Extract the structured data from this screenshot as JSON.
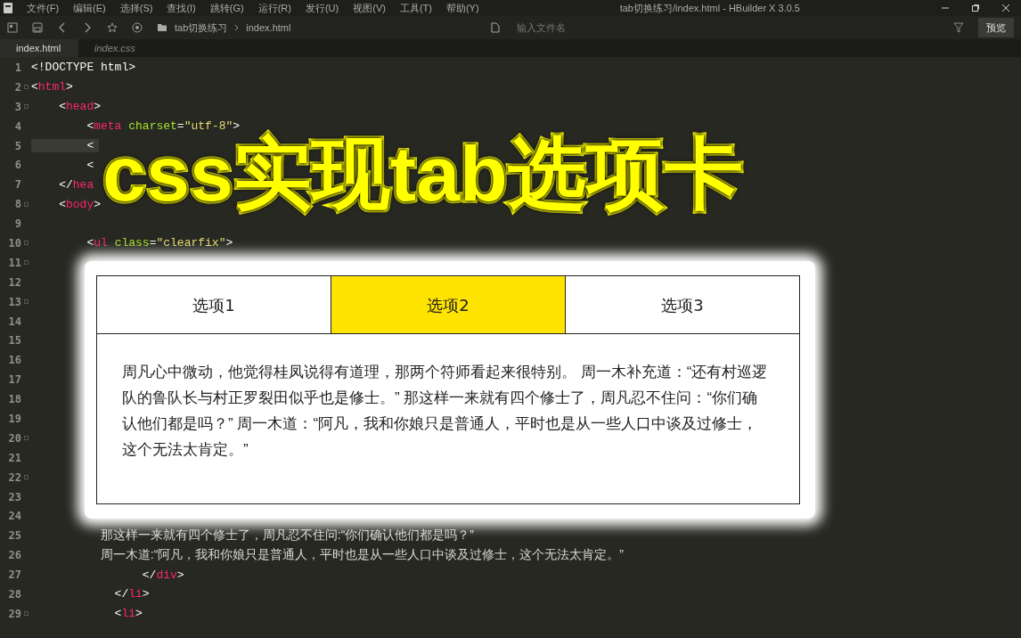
{
  "window": {
    "title": "tab切换练习/index.html - HBuilder X 3.0.5"
  },
  "menu": [
    "文件(F)",
    "编辑(E)",
    "选择(S)",
    "查找(I)",
    "跳转(G)",
    "运行(R)",
    "发行(U)",
    "视图(V)",
    "工具(T)",
    "帮助(Y)"
  ],
  "breadcrumb": [
    "tab切换练习",
    "index.html"
  ],
  "search": {
    "placeholder": "输入文件名"
  },
  "preview_button": "预览",
  "editor_tabs": [
    {
      "label": "index.html",
      "selected": true
    },
    {
      "label": "index.css",
      "selected": false
    }
  ],
  "code_lines": [
    {
      "number": "1",
      "fold": false,
      "current": false,
      "tokens": [
        {
          "kind": "punct",
          "text": "<!DOCTYPE html>"
        }
      ]
    },
    {
      "number": "2",
      "fold": true,
      "current": false,
      "tokens": [
        {
          "kind": "punct",
          "text": "<"
        },
        {
          "kind": "tag",
          "text": "html"
        },
        {
          "kind": "punct",
          "text": ">"
        }
      ]
    },
    {
      "number": "3",
      "fold": true,
      "current": false,
      "tokens": [
        {
          "kind": "punct",
          "text": "    <"
        },
        {
          "kind": "tag",
          "text": "head"
        },
        {
          "kind": "punct",
          "text": ">"
        }
      ]
    },
    {
      "number": "4",
      "fold": false,
      "current": false,
      "tokens": [
        {
          "kind": "punct",
          "text": "        <"
        },
        {
          "kind": "tag",
          "text": "meta"
        },
        {
          "kind": "attr",
          "text": " charset"
        },
        {
          "kind": "punct",
          "text": "="
        },
        {
          "kind": "string",
          "text": "\"utf-8\""
        },
        {
          "kind": "punct",
          "text": ">"
        }
      ]
    },
    {
      "number": "5",
      "fold": false,
      "current": true,
      "tokens": [
        {
          "kind": "punct",
          "text": "        <"
        }
      ]
    },
    {
      "number": "6",
      "fold": false,
      "current": false,
      "tokens": [
        {
          "kind": "punct",
          "text": "        <"
        }
      ]
    },
    {
      "number": "7",
      "fold": false,
      "current": false,
      "tokens": [
        {
          "kind": "punct",
          "text": "    </"
        },
        {
          "kind": "tag",
          "text": "hea"
        }
      ]
    },
    {
      "number": "8",
      "fold": true,
      "current": false,
      "tokens": [
        {
          "kind": "punct",
          "text": "    <"
        },
        {
          "kind": "tag",
          "text": "body"
        },
        {
          "kind": "punct",
          "text": ">"
        }
      ]
    },
    {
      "number": "9",
      "fold": false,
      "current": false
    },
    {
      "number": "10",
      "fold": true,
      "current": false,
      "tokens": [
        {
          "kind": "punct",
          "text": "        <"
        },
        {
          "kind": "tag",
          "text": "ul"
        },
        {
          "kind": "attr",
          "text": " class"
        },
        {
          "kind": "punct",
          "text": "="
        },
        {
          "kind": "string",
          "text": "\"clearfix\""
        },
        {
          "kind": "punct",
          "text": ">"
        }
      ]
    },
    {
      "number": "11",
      "fold": true,
      "current": false
    },
    {
      "number": "12",
      "fold": false,
      "current": false
    },
    {
      "number": "13",
      "fold": true,
      "current": false
    },
    {
      "number": "14",
      "fold": false,
      "current": false
    },
    {
      "number": "15",
      "fold": false,
      "current": false
    },
    {
      "number": "16",
      "fold": false,
      "current": false
    },
    {
      "number": "17",
      "fold": false,
      "current": false
    },
    {
      "number": "18",
      "fold": false,
      "current": false
    },
    {
      "number": "19",
      "fold": false,
      "current": false
    },
    {
      "number": "20",
      "fold": true,
      "current": false
    },
    {
      "number": "21",
      "fold": false,
      "current": false
    },
    {
      "number": "22",
      "fold": true,
      "current": false
    },
    {
      "number": "23",
      "fold": false,
      "current": false
    },
    {
      "number": "24",
      "fold": false,
      "current": false
    },
    {
      "number": "25",
      "fold": false,
      "current": false,
      "tokens": [
        {
          "kind": "text",
          "text": "                    那这样一来就有四个修士了，周凡忍不住问:“你们确认他们都是吗？”"
        }
      ]
    },
    {
      "number": "26",
      "fold": false,
      "current": false,
      "tokens": [
        {
          "kind": "text",
          "text": "                    周一木道:“阿凡，我和你娘只是普通人，平时也是从一些人口中谈及过修士，这个无法太肯定。”"
        }
      ]
    },
    {
      "number": "27",
      "fold": false,
      "current": false,
      "tokens": [
        {
          "kind": "punct",
          "text": "                </"
        },
        {
          "kind": "tag",
          "text": "div"
        },
        {
          "kind": "punct",
          "text": ">"
        }
      ]
    },
    {
      "number": "28",
      "fold": false,
      "current": false,
      "tokens": [
        {
          "kind": "punct",
          "text": "            </"
        },
        {
          "kind": "tag",
          "text": "li"
        },
        {
          "kind": "punct",
          "text": ">"
        }
      ]
    },
    {
      "number": "29",
      "fold": true,
      "current": false,
      "tokens": [
        {
          "kind": "punct",
          "text": "            <"
        },
        {
          "kind": "tag",
          "text": "li"
        },
        {
          "kind": "punct",
          "text": ">"
        }
      ]
    }
  ],
  "headline": "css实现tab选项卡",
  "demo": {
    "tabs": [
      {
        "label": "选项1",
        "selected": false
      },
      {
        "label": "选项2",
        "selected": true
      },
      {
        "label": "选项3",
        "selected": false
      }
    ],
    "content": "周凡心中微动，他觉得桂凤说得有道理，那两个符师看起来很特别。 周一木补充道：“还有村巡逻队的鲁队长与村正罗裂田似乎也是修士。” 那这样一来就有四个修士了，周凡忍不住问：“你们确认他们都是吗？” 周一木道：“阿凡，我和你娘只是普通人，平时也是从一些人口中谈及过修士，这个无法太肯定。”"
  }
}
